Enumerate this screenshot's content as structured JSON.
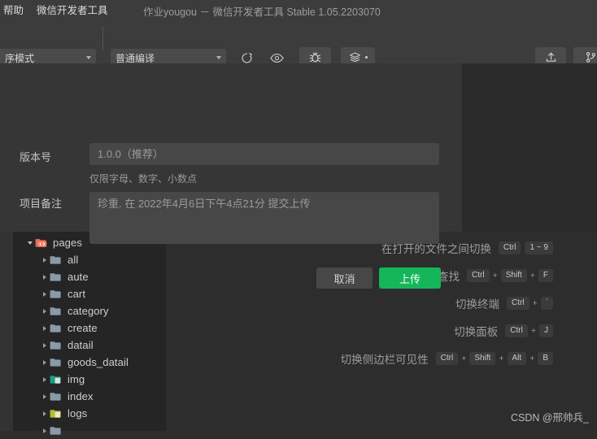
{
  "titlebar": {
    "menus": [
      "帮助",
      "微信开发者工具"
    ],
    "window_title": "作业yougou － 微信开发者工具 Stable 1.05.2203070"
  },
  "toolbar": {
    "mode_select": "序模式",
    "compile_select": "普通编译",
    "buttons": [
      {
        "label": "编译",
        "icon": "refresh-icon"
      },
      {
        "label": "预览",
        "icon": "eye-icon"
      },
      {
        "label": "真机调试",
        "icon": "bug-icon"
      },
      {
        "label": "清缓存",
        "icon": "layers-icon"
      }
    ],
    "right_buttons": [
      {
        "label": "上传",
        "icon": "upload-icon"
      },
      {
        "label": "版本管",
        "icon": "git-branch-icon"
      }
    ]
  },
  "dialog": {
    "version_label": "版本号",
    "version_placeholder": "1.0.0（推荐）",
    "version_value": "",
    "version_help": "仅限字母、数字、小数点",
    "remark_label": "项目备注",
    "remark_placeholder": "珍重. 在 2022年4月6日下午4点21分 提交上传",
    "remark_value": "",
    "cancel_label": "取消",
    "submit_label": "上传",
    "submit_color": "#15b659"
  },
  "explorer": {
    "tree": [
      {
        "label": "pages",
        "indent": 0,
        "expanded": true,
        "icon": "folder-open-red"
      },
      {
        "label": "all",
        "indent": 1,
        "expanded": false,
        "icon": "folder-blue"
      },
      {
        "label": "aute",
        "indent": 1,
        "expanded": false,
        "icon": "folder-blue"
      },
      {
        "label": "cart",
        "indent": 1,
        "expanded": false,
        "icon": "folder-blue"
      },
      {
        "label": "category",
        "indent": 1,
        "expanded": false,
        "icon": "folder-blue"
      },
      {
        "label": "create",
        "indent": 1,
        "expanded": false,
        "icon": "folder-blue"
      },
      {
        "label": "datail",
        "indent": 1,
        "expanded": false,
        "icon": "folder-blue"
      },
      {
        "label": "goods_datail",
        "indent": 1,
        "expanded": false,
        "icon": "folder-blue"
      },
      {
        "label": "img",
        "indent": 1,
        "expanded": false,
        "icon": "folder-teal"
      },
      {
        "label": "index",
        "indent": 1,
        "expanded": false,
        "icon": "folder-blue"
      },
      {
        "label": "logs",
        "indent": 1,
        "expanded": false,
        "icon": "folder-yellow"
      },
      {
        "label": "",
        "indent": 1,
        "expanded": false,
        "icon": "folder-blue"
      }
    ]
  },
  "shortcuts": [
    {
      "text": "在打开的文件之间切换",
      "keys": [
        "Ctrl",
        "1 ~ 9"
      ],
      "joiner": "gap"
    },
    {
      "text": "在文件中查找",
      "keys": [
        "Ctrl",
        "Shift",
        "F"
      ],
      "joiner": "plus"
    },
    {
      "text": "切换终端",
      "keys": [
        "Ctrl",
        "`"
      ],
      "joiner": "plus"
    },
    {
      "text": "切换面板",
      "keys": [
        "Ctrl",
        "J"
      ],
      "joiner": "plus"
    },
    {
      "text": "切换侧边栏可见性",
      "keys": [
        "Ctrl",
        "Shift",
        "Alt",
        "B"
      ],
      "joiner": "plus"
    }
  ],
  "watermark": "CSDN @邢帅兵_"
}
